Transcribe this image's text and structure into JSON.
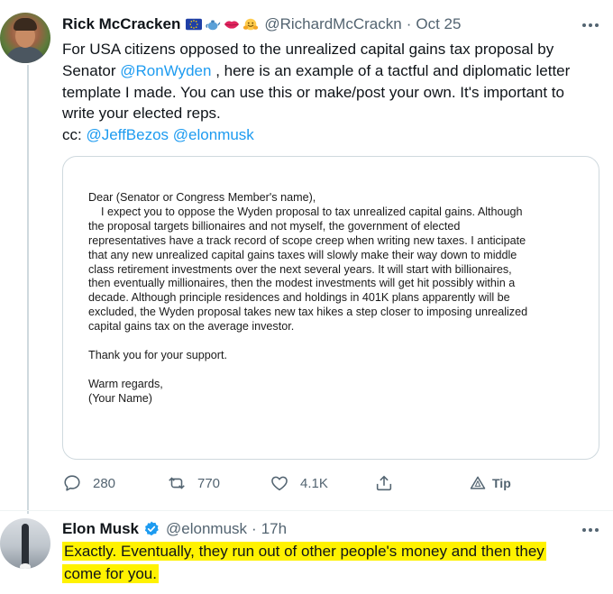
{
  "tweet_original": {
    "author_name": "Rick McCracken",
    "emoji_icons": [
      "eu-flag-icon",
      "teapot-icon",
      "lips-icon",
      "hugging-face-icon"
    ],
    "handle": "@RichardMcCrackn",
    "separator": "·",
    "time": "Oct 25",
    "text_lines": [
      {
        "parts": [
          {
            "text": "For USA citizens opposed to the unrealized capital gains tax proposal by"
          }
        ]
      },
      {
        "parts": [
          {
            "text": "Senator "
          },
          {
            "text": "@RonWyden",
            "link": true
          },
          {
            "text": " , here is an example of a tactful and diplomatic letter"
          }
        ]
      },
      {
        "parts": [
          {
            "text": "template I made. You can use this or make/post your own. It's important to"
          }
        ]
      },
      {
        "parts": [
          {
            "text": "write your elected reps."
          }
        ]
      },
      {
        "parts": [
          {
            "text": "cc: "
          },
          {
            "text": "@JeffBezos",
            "link": true
          },
          {
            "text": " "
          },
          {
            "text": "@elonmusk",
            "link": true
          }
        ]
      }
    ],
    "letter": {
      "greeting": "Dear (Senator or Congress Member's name),",
      "body_lines": [
        "    I expect you to oppose the Wyden proposal to tax unrealized capital gains. Although",
        "the proposal targets billionaires and not myself, the government of elected",
        "representatives have a track record of scope creep when writing new taxes. I anticipate",
        "that any new unrealized capital gains taxes will slowly make their way down to middle",
        "class retirement investments over the next several years. It will start with billionaires,",
        "then eventually millionaires, then the modest investments will get hit possibly within a",
        "decade. Although principle residences and holdings in 401K plans apparently will be",
        "excluded, the Wyden proposal takes new tax hikes a step closer to imposing unrealized",
        "capital gains tax on the average investor."
      ],
      "thanks": "Thank you for your support.",
      "closing": "Warm regards,",
      "signature": "(Your Name)"
    },
    "actions": {
      "reply_count": "280",
      "retweet_count": "770",
      "like_count": "4.1K",
      "tip_label": "Tip"
    }
  },
  "tweet_reply": {
    "author_name": "Elon Musk",
    "handle": "@elonmusk",
    "separator": "·",
    "time": "17h",
    "text_lines": [
      "Exactly. Eventually, they run out of other people's money and then they",
      "come for you."
    ],
    "highlight_color": "#fff200"
  },
  "colors": {
    "link": "#1d9bf0",
    "secondary_text": "#536471",
    "primary_text": "#0f1419",
    "thread_line": "#cfd9de"
  }
}
